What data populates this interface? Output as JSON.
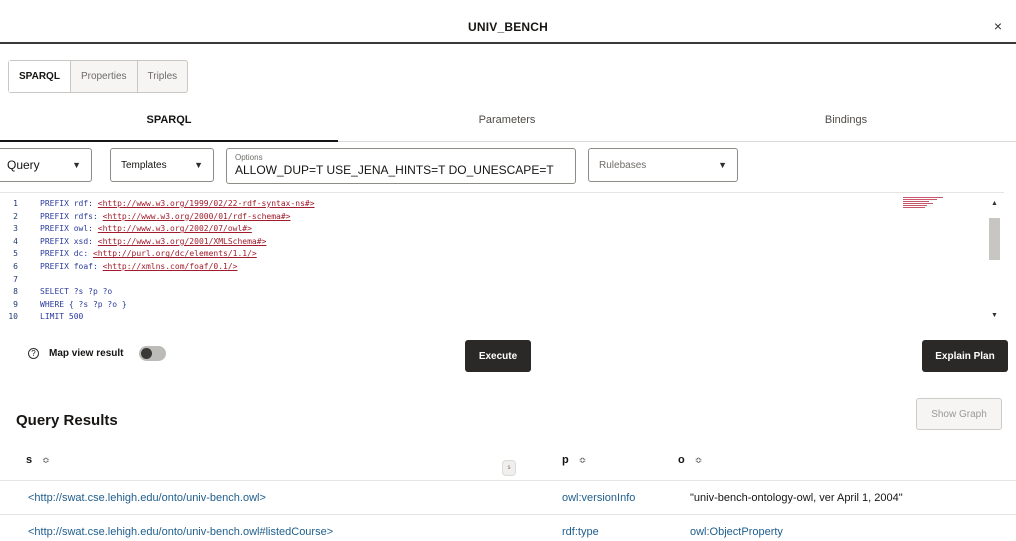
{
  "dialog": {
    "title": "UNIV_BENCH",
    "close": "×"
  },
  "segments": [
    "SPARQL",
    "Properties",
    "Triples"
  ],
  "tabs": [
    "SPARQL",
    "Parameters",
    "Bindings"
  ],
  "controls": {
    "query_select": "Query",
    "templates_select": "Templates",
    "options_label": "Options",
    "options_value": "ALLOW_DUP=T USE_JENA_HINTS=T DO_UNESCAPE=T",
    "rulebases_placeholder": "Rulebases"
  },
  "editor": {
    "lines": [
      {
        "n": "1",
        "kw": "PREFIX rdf: ",
        "uri": "<http://www.w3.org/1999/02/22-rdf-syntax-ns#>"
      },
      {
        "n": "2",
        "kw": "PREFIX rdfs: ",
        "uri": "<http://www.w3.org/2000/01/rdf-schema#>"
      },
      {
        "n": "3",
        "kw": "PREFIX owl: ",
        "uri": "<http://www.w3.org/2002/07/owl#>"
      },
      {
        "n": "4",
        "kw": "PREFIX xsd: ",
        "uri": "<http://www.w3.org/2001/XMLSchema#>"
      },
      {
        "n": "5",
        "kw": "PREFIX dc: ",
        "uri": "<http://purl.org/dc/elements/1.1/>"
      },
      {
        "n": "6",
        "kw": "PREFIX foaf: ",
        "uri": "<http://xmlns.com/foaf/0.1/>"
      },
      {
        "n": "7",
        "kw": "",
        "uri": ""
      },
      {
        "n": "8",
        "kw": "SELECT ?s ?p ?o",
        "uri": ""
      },
      {
        "n": "9",
        "kw": "WHERE { ?s ?p ?o }",
        "uri": ""
      },
      {
        "n": "10",
        "kw": "LIMIT 500",
        "uri": ""
      }
    ]
  },
  "map_view_label": "Map view result",
  "buttons": {
    "execute": "Execute",
    "explain": "Explain Plan",
    "show_graph": "Show Graph"
  },
  "results": {
    "title": "Query Results",
    "columns": [
      "s",
      "p",
      "o"
    ],
    "sort_glyph": "≎",
    "resizer_glyph": "s",
    "rows": [
      {
        "s": "<http://swat.cse.lehigh.edu/onto/univ-bench.owl>",
        "p": "owl:versionInfo",
        "o": "\"univ-bench-ontology-owl, ver April 1, 2004\""
      },
      {
        "s": "<http://swat.cse.lehigh.edu/onto/univ-bench.owl#listedCourse>",
        "p": "rdf:type",
        "o": "owl:ObjectProperty"
      }
    ]
  }
}
